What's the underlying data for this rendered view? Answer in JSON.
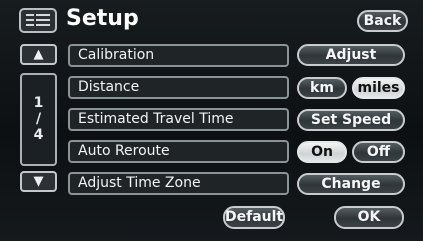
{
  "header": {
    "title": "Setup",
    "back_label": "Back",
    "menu_icon": "list-icon"
  },
  "nav": {
    "up_icon": "▲",
    "down_icon": "▼",
    "page_current": "1",
    "page_sep": "/",
    "page_total": "4"
  },
  "rows": [
    {
      "label": "Calibration",
      "buttons": [
        {
          "label": "Adjust",
          "active": false
        }
      ]
    },
    {
      "label": "Distance",
      "buttons": [
        {
          "label": "km",
          "active": false
        },
        {
          "label": "miles",
          "active": true
        }
      ]
    },
    {
      "label": "Estimated Travel Time",
      "buttons": [
        {
          "label": "Set Speed",
          "active": false
        }
      ]
    },
    {
      "label": "Auto Reroute",
      "buttons": [
        {
          "label": "On",
          "active": true
        },
        {
          "label": "Off",
          "active": false
        }
      ]
    },
    {
      "label": "Adjust Time Zone",
      "buttons": [
        {
          "label": "Change",
          "active": false
        }
      ]
    }
  ],
  "footer": {
    "default_label": "Default",
    "ok_label": "OK"
  }
}
